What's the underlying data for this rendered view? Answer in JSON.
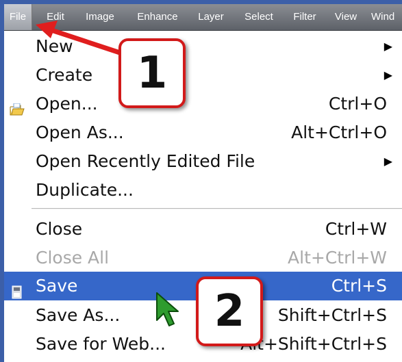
{
  "menubar": {
    "items": [
      "File",
      "Edit",
      "Image",
      "Enhance",
      "Layer",
      "Select",
      "Filter",
      "View",
      "Wind"
    ]
  },
  "menu": {
    "items": [
      {
        "label": "New",
        "shortcut": "",
        "submenu": true
      },
      {
        "label": "Create",
        "shortcut": "",
        "submenu": true
      },
      {
        "label": "Open...",
        "shortcut": "Ctrl+O",
        "icon": "folder-icon"
      },
      {
        "label": "Open As...",
        "shortcut": "Alt+Ctrl+O"
      },
      {
        "label": "Open Recently Edited File",
        "shortcut": "",
        "submenu": true
      },
      {
        "label": "Duplicate...",
        "shortcut": ""
      },
      {
        "label": "Close",
        "shortcut": "Ctrl+W"
      },
      {
        "label": "Close All",
        "shortcut": "Alt+Ctrl+W",
        "disabled": true
      },
      {
        "label": "Save",
        "shortcut": "Ctrl+S",
        "icon": "save-icon",
        "highlighted": true
      },
      {
        "label": "Save As...",
        "shortcut": "Shift+Ctrl+S"
      },
      {
        "label": "Save for Web...",
        "shortcut": "Alt+Shift+Ctrl+S"
      }
    ],
    "submenu_glyph": "▶"
  },
  "callouts": {
    "one": "1",
    "two": "2"
  },
  "colors": {
    "highlight": "#3667c9",
    "callout_border": "#d21a1a",
    "arrow_red": "#e01e1e",
    "cursor_green": "#2e9c2e"
  }
}
